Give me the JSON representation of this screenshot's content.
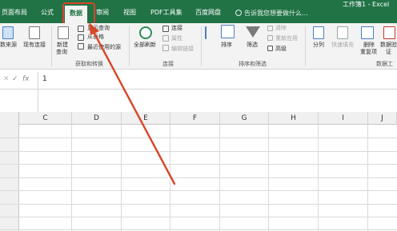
{
  "window": {
    "title": "工作簿1 - Excel"
  },
  "tabs": [
    {
      "label": "页面布局"
    },
    {
      "label": "公式"
    },
    {
      "label": "数据",
      "active": true
    },
    {
      "label": "审阅"
    },
    {
      "label": "视图"
    },
    {
      "label": "PDF工具集"
    },
    {
      "label": "百度网盘"
    }
  ],
  "tell_me": {
    "placeholder": "告诉我您想要做什么..."
  },
  "ribbon": {
    "get_external": {
      "label": "数来源"
    },
    "existing_conn": {
      "label": "现有连接"
    },
    "new_query": {
      "line1": "新建",
      "line2": "查询"
    },
    "show_query": {
      "label": "显示查询"
    },
    "from_table": {
      "label": "从表格"
    },
    "recent_sources": {
      "label": "最近使用的源"
    },
    "group_get_transform": "获取和转换",
    "refresh_all": {
      "label": "全部刷新"
    },
    "connections": {
      "label": "连接"
    },
    "properties": {
      "label": "属性"
    },
    "edit_links": {
      "label": "编辑链接"
    },
    "group_connections": "连接",
    "sort": {
      "label": "排序"
    },
    "filter": {
      "label": "筛选"
    },
    "clear": {
      "label": "清除"
    },
    "reapply": {
      "label": "重新应用"
    },
    "advanced": {
      "label": "高级"
    },
    "group_sort_filter": "排序和筛选",
    "split": {
      "label": "分列"
    },
    "flash_fill": {
      "label": "快速填充"
    },
    "remove_dup": {
      "line1": "删除",
      "line2": "重复项"
    },
    "validation": {
      "line1": "数据验",
      "line2": "证"
    },
    "group_data_tools": "数据工"
  },
  "formula_bar": {
    "cancel_glyph": "✕",
    "enter_glyph": "✓",
    "fx_glyph": "fx",
    "value": "1"
  },
  "columns": [
    "C",
    "D",
    "E",
    "F",
    "G",
    "H",
    "I",
    "J"
  ],
  "colors": {
    "accent": "#217346",
    "annotation": "#d8462a"
  }
}
